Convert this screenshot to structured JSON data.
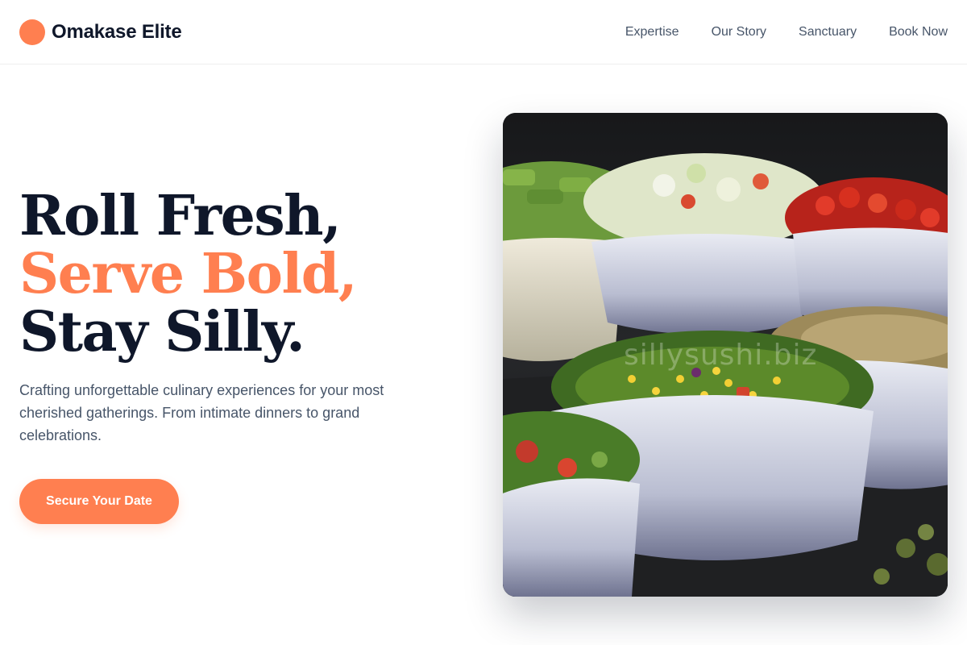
{
  "brand": {
    "name": "Omakase Elite",
    "accent": "#ff7f50"
  },
  "nav": {
    "items": [
      "Expertise",
      "Our Story",
      "Sanctuary",
      "Book Now"
    ]
  },
  "hero": {
    "headline": [
      "Roll Fresh,",
      "Serve Bold,",
      "Stay Silly."
    ],
    "subtitle": "Crafting unforgettable culinary experiences for your most cherished gatherings. From intimate dinners to grand celebrations.",
    "cta_label": "Secure Your Date",
    "image": {
      "alt": "bowls of fresh salads",
      "watermark": "sillysushi.biz"
    }
  },
  "colors": {
    "text_dark": "#0f172a",
    "text_muted": "#475569",
    "accent": "#ff7f50"
  }
}
